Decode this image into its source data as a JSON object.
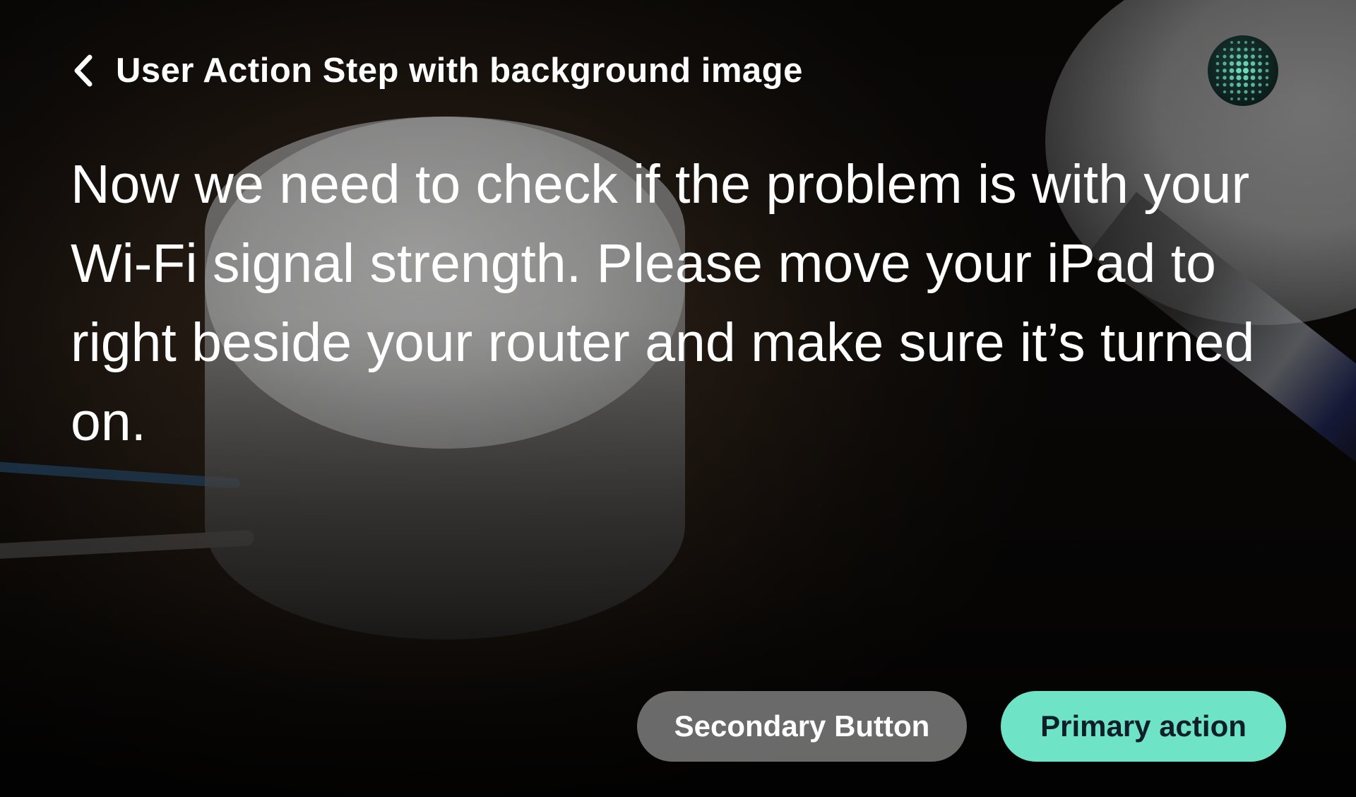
{
  "header": {
    "title": "User Action Step with background image",
    "back_icon": "chevron-left-icon",
    "assistant_icon": "assistant-orb-icon"
  },
  "main": {
    "message": "Now we need to check if the problem is with your Wi-Fi signal strength. Please move your iPad to right beside your router and make sure it’s turned on."
  },
  "actions": {
    "secondary_label": "Secondary Button",
    "primary_label": "Primary action"
  },
  "colors": {
    "primary_button": "#6fe3c6",
    "primary_button_text": "#0f1f2a",
    "secondary_button": "#aaaaaa",
    "text": "#ffffff",
    "orb_dots": "#6fe3c6"
  }
}
